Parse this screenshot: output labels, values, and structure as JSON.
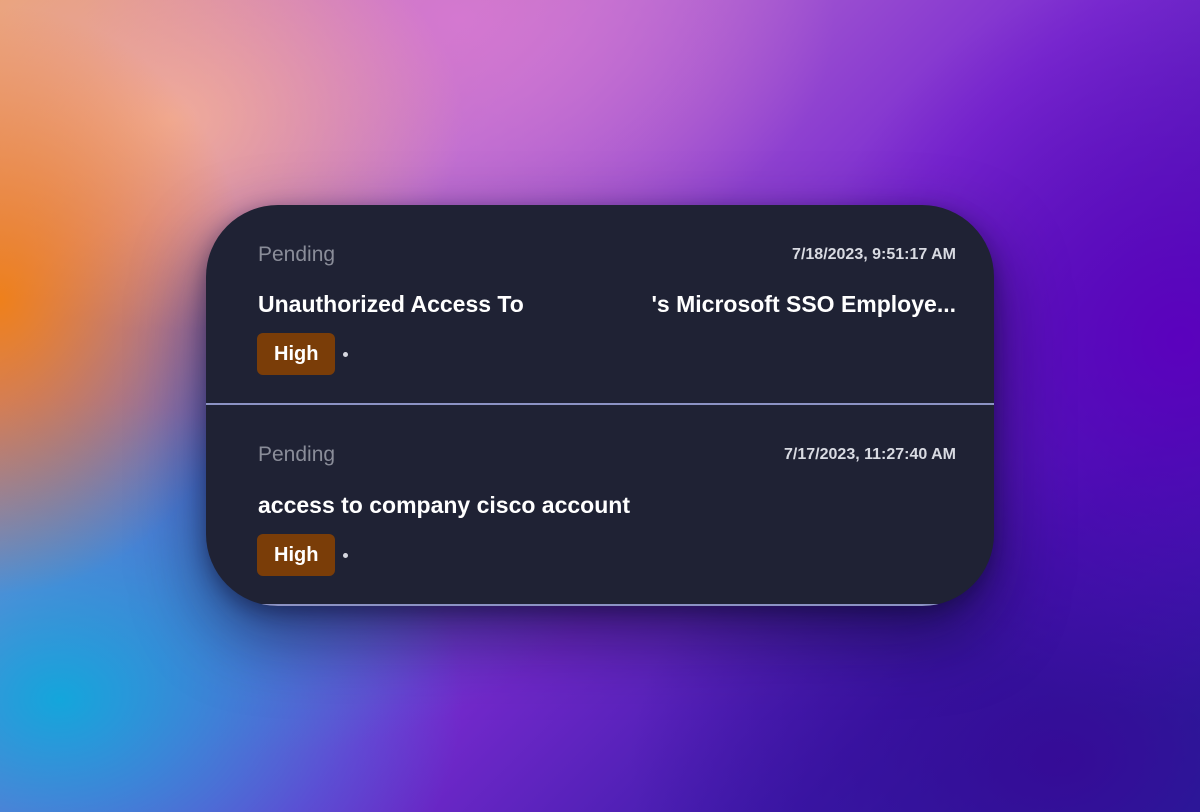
{
  "alerts": [
    {
      "status": "Pending",
      "timestamp": "7/18/2023, 9:51:17 AM",
      "title_start": "Unauthorized Access To",
      "title_end": "'s Microsoft SSO Employe...",
      "severity": "High"
    },
    {
      "status": "Pending",
      "timestamp": "7/17/2023, 11:27:40 AM",
      "title_start": "access to company cisco account",
      "title_end": "",
      "severity": "High"
    }
  ],
  "colors": {
    "card_background": "#1f2234",
    "severity_high": "#7a3d08",
    "divider": "#8c93c4",
    "status_text": "#8a8d99"
  }
}
